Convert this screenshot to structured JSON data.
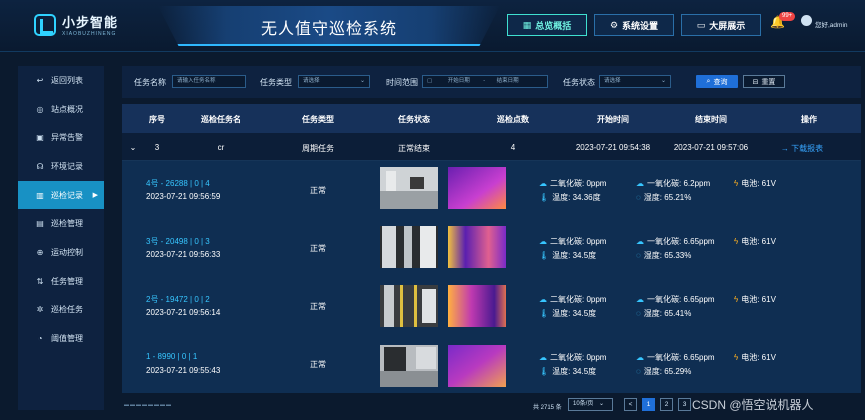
{
  "header": {
    "logo_cn": "小步智能",
    "logo_en": "XIAOBUZHINENG",
    "title": "无人值守巡检系统",
    "nav": [
      {
        "label": "总览概括",
        "icon": "grid-icon"
      },
      {
        "label": "系统设置",
        "icon": "gear-icon"
      },
      {
        "label": "大屏展示",
        "icon": "monitor-icon"
      }
    ],
    "badge": "99+",
    "user": "您好,admin"
  },
  "sidebar": {
    "items": [
      {
        "label": "返回列表",
        "icon": "back-icon"
      },
      {
        "label": "站点概况",
        "icon": "location-icon"
      },
      {
        "label": "异常告警",
        "icon": "alert-icon"
      },
      {
        "label": "环境记录",
        "icon": "environment-icon"
      },
      {
        "label": "巡检记录",
        "icon": "record-icon"
      },
      {
        "label": "巡检管理",
        "icon": "manage-icon"
      },
      {
        "label": "运动控制",
        "icon": "control-icon"
      },
      {
        "label": "任务管理",
        "icon": "task-icon"
      },
      {
        "label": "巡检任务",
        "icon": "inspect-icon"
      },
      {
        "label": "阈值管理",
        "icon": "threshold-icon"
      }
    ],
    "active_index": 4
  },
  "filters": {
    "task_name_label": "任务名称",
    "task_name_placeholder": "请输入任务名称",
    "task_type_label": "任务类型",
    "task_type_placeholder": "请选择",
    "time_range_label": "时间范围",
    "start_placeholder": "开始日期",
    "range_sep": "-",
    "end_placeholder": "结束日期",
    "task_status_label": "任务状态",
    "task_status_placeholder": "请选择",
    "query_label": "查询",
    "reset_label": "重置"
  },
  "table": {
    "headers": [
      "序号",
      "巡检任务名",
      "任务类型",
      "任务状态",
      "巡检点数",
      "开始时间",
      "结束时间",
      "操作"
    ],
    "summary": {
      "index": "3",
      "name": "cr",
      "type": "周期任务",
      "status": "正常结束",
      "points": "4",
      "start": "2023-07-21 09:54:38",
      "end": "2023-07-21 09:57:06",
      "action": "下载报表"
    },
    "records": [
      {
        "title": "4号 - 26288 | 0 | 4",
        "time": "2023-07-21 09:56:59",
        "status": "正常",
        "co2": "二氧化碳: 0ppm",
        "co": "一氧化碳: 6.2ppm",
        "battery": "电池: 61V",
        "temp": "温度: 34.36度",
        "humidity": "湿度: 65.21%"
      },
      {
        "title": "3号 - 20498 | 0 | 3",
        "time": "2023-07-21 09:56:33",
        "status": "正常",
        "co2": "二氧化碳: 0ppm",
        "co": "一氧化碳: 6.65ppm",
        "battery": "电池: 61V",
        "temp": "温度: 34.5度",
        "humidity": "湿度: 65.33%"
      },
      {
        "title": "2号 - 19472 | 0 | 2",
        "time": "2023-07-21 09:56:14",
        "status": "正常",
        "co2": "二氧化碳: 0ppm",
        "co": "一氧化碳: 6.65ppm",
        "battery": "电池: 61V",
        "temp": "温度: 34.5度",
        "humidity": "湿度: 65.41%"
      },
      {
        "title": "1 - 8990 | 0 | 1",
        "time": "2023-07-21 09:55:43",
        "status": "正常",
        "co2": "二氧化碳: 0ppm",
        "co": "一氧化碳: 6.65ppm",
        "battery": "电池: 61V",
        "temp": "温度: 34.5度",
        "humidity": "湿度: 65.29%"
      }
    ]
  },
  "pagination": {
    "total": "共 2715 条",
    "page_size": "10条/页",
    "prev": "<",
    "pages": [
      "1",
      "2",
      "3"
    ],
    "current": "1"
  },
  "watermark": "CSDN @悟空说机器人"
}
